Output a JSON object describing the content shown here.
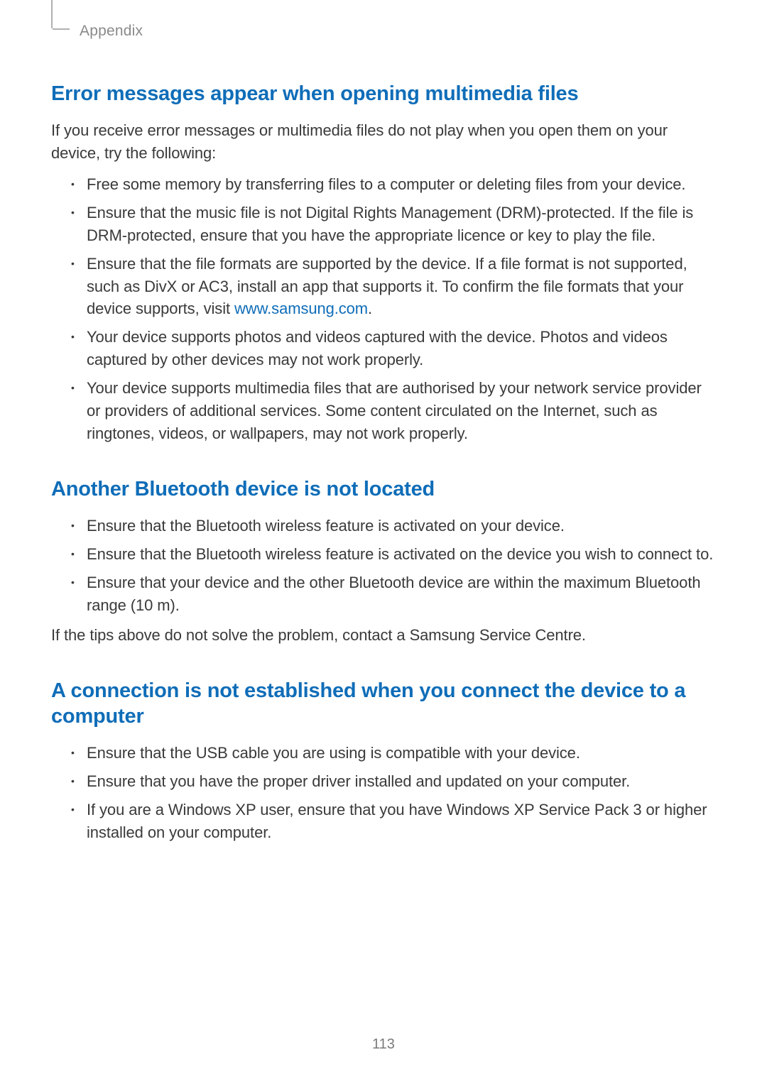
{
  "header": {
    "section_label": "Appendix"
  },
  "section1": {
    "heading": "Error messages appear when opening multimedia files",
    "intro": "If you receive error messages or multimedia files do not play when you open them on your device, try the following:",
    "bullets": [
      {
        "text": "Free some memory by transferring files to a computer or deleting files from your device."
      },
      {
        "text": "Ensure that the music file is not Digital Rights Management (DRM)-protected. If the file is DRM-protected, ensure that you have the appropriate licence or key to play the file."
      },
      {
        "pre": "Ensure that the file formats are supported by the device. If a file format is not supported, such as DivX or AC3, install an app that supports it. To confirm the file formats that your device supports, visit ",
        "link": "www.samsung.com",
        "post": "."
      },
      {
        "text": "Your device supports photos and videos captured with the device. Photos and videos captured by other devices may not work properly."
      },
      {
        "text": "Your device supports multimedia files that are authorised by your network service provider or providers of additional services. Some content circulated on the Internet, such as ringtones, videos, or wallpapers, may not work properly."
      }
    ]
  },
  "section2": {
    "heading": "Another Bluetooth device is not located",
    "bullets": [
      {
        "text": "Ensure that the Bluetooth wireless feature is activated on your device."
      },
      {
        "text": "Ensure that the Bluetooth wireless feature is activated on the device you wish to connect to."
      },
      {
        "text": "Ensure that your device and the other Bluetooth device are within the maximum Bluetooth range (10 m)."
      }
    ],
    "closing": "If the tips above do not solve the problem, contact a Samsung Service Centre."
  },
  "section3": {
    "heading": "A connection is not established when you connect the device to a computer",
    "bullets": [
      {
        "text": "Ensure that the USB cable you are using is compatible with your device."
      },
      {
        "text": "Ensure that you have the proper driver installed and updated on your computer."
      },
      {
        "text": "If you are a Windows XP user, ensure that you have Windows XP Service Pack 3 or higher installed on your computer."
      }
    ]
  },
  "page_number": "113"
}
